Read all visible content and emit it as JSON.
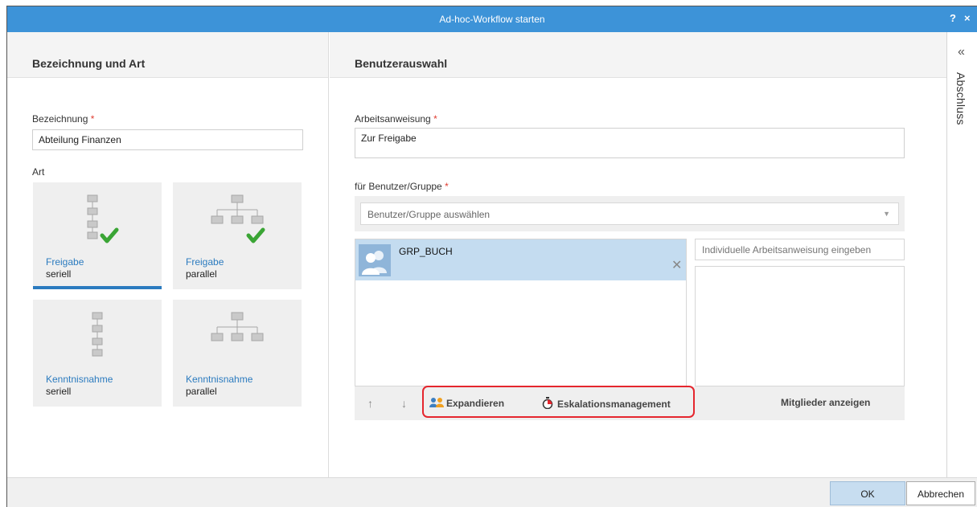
{
  "window": {
    "title": "Ad-hoc-Workflow starten",
    "help_label": "?",
    "close_label": "×"
  },
  "side_panel": {
    "chevron": "«",
    "label": "Abschluss"
  },
  "left": {
    "heading": "Bezeichnung und Art",
    "name_label": "Bezeichnung",
    "required_mark": "*",
    "name_value": "Abteilung Finanzen",
    "type_label": "Art",
    "tiles": [
      {
        "title": "Freigabe",
        "subtitle": "seriell",
        "icon": "serial-hierarchy-check-icon"
      },
      {
        "title": "Freigabe",
        "subtitle": "parallel",
        "icon": "parallel-hierarchy-check-icon"
      },
      {
        "title": "Kenntnisnahme",
        "subtitle": "seriell",
        "icon": "serial-hierarchy-icon"
      },
      {
        "title": "Kenntnisnahme",
        "subtitle": "parallel",
        "icon": "parallel-hierarchy-icon"
      }
    ],
    "selected_tile": 0
  },
  "right": {
    "heading": "Benutzerauswahl",
    "instruction_label": "Arbeitsanweisung",
    "instruction_value": "Zur Freigabe",
    "user_label": "für Benutzer/Gruppe",
    "user_placeholder": "Benutzer/Gruppe auswählen",
    "users": [
      {
        "name": "GRP_BUCH",
        "icon": "group-avatar-icon"
      }
    ],
    "individual_instruction_placeholder": "Individuelle Arbeitsanweisung eingeben",
    "toolbar": {
      "up": "↑",
      "down": "↓",
      "expand": "Expandieren",
      "escalation": "Eskalationsmanagement",
      "show_members": "Mitglieder anzeigen"
    }
  },
  "footer": {
    "ok": "OK",
    "cancel": "Abbrechen"
  },
  "colors": {
    "titlebar": "#3d93d8",
    "accent": "#2b7bbf",
    "check": "#3aa535",
    "highlight": "#e5262e"
  }
}
